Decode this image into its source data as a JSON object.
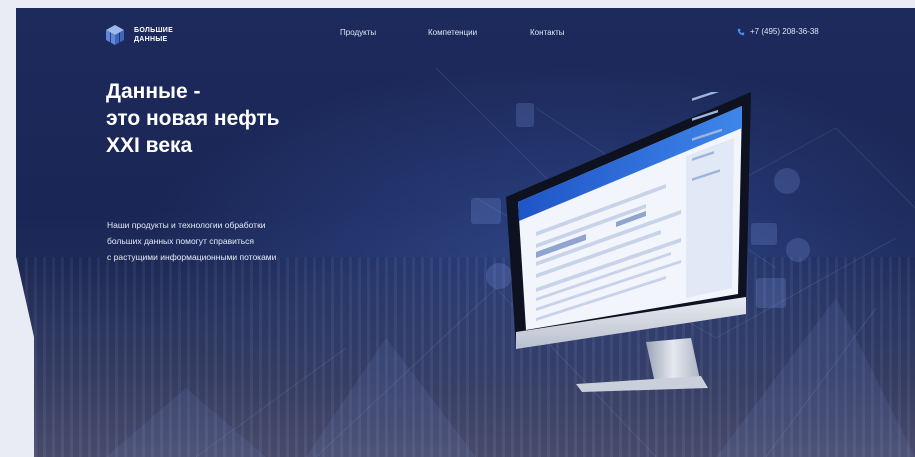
{
  "brand": {
    "line1": "БОЛЬШИЕ",
    "line2": "ДАННЫЕ",
    "icon": "cube-logo-icon"
  },
  "nav": {
    "items": [
      {
        "label": "Продукты"
      },
      {
        "label": "Компетенции"
      },
      {
        "label": "Контакты"
      }
    ]
  },
  "phone": {
    "number": "+7 (495) 208-36-38",
    "icon": "phone-icon"
  },
  "hero": {
    "title_lines": [
      "Данные -",
      "это новая нефть",
      "XXI века"
    ],
    "subtitle_lines": [
      "Наши продукты и технологии обработки",
      "больших данных помогут справиться",
      "с растущими информационными потоками"
    ]
  },
  "colors": {
    "background": "#1d2a5c",
    "accent": "#3d7be6",
    "text": "#ffffff"
  }
}
